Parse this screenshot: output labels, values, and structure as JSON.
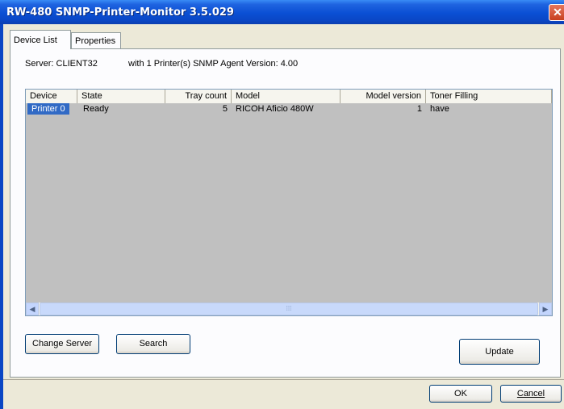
{
  "window": {
    "title": "RW-480 SNMP-Printer-Monitor 3.5.029",
    "close_glyph": "✕"
  },
  "tabs": [
    {
      "label": "Device List",
      "active": true
    },
    {
      "label": "Properties",
      "active": false
    }
  ],
  "server": {
    "label": "Server: CLIENT32",
    "info": "with 1 Printer(s)  SNMP Agent Version: 4.00"
  },
  "list": {
    "columns": [
      "Device",
      "State",
      "Tray count",
      "Model",
      "Model version",
      "Toner Filling"
    ],
    "rows": [
      {
        "device": "Printer 0",
        "state": "Ready",
        "tray_count": "5",
        "model": "RICOH Aficio 480W",
        "model_version": "1",
        "toner": "have",
        "selected": true
      }
    ]
  },
  "scrollbar": {
    "left_arrow": "◀",
    "right_arrow": "▶",
    "grip": "⁞⁞⁞"
  },
  "buttons": {
    "change_server": "Change Server",
    "search": "Search",
    "update": "Update",
    "ok": "OK",
    "cancel": "Cancel"
  }
}
